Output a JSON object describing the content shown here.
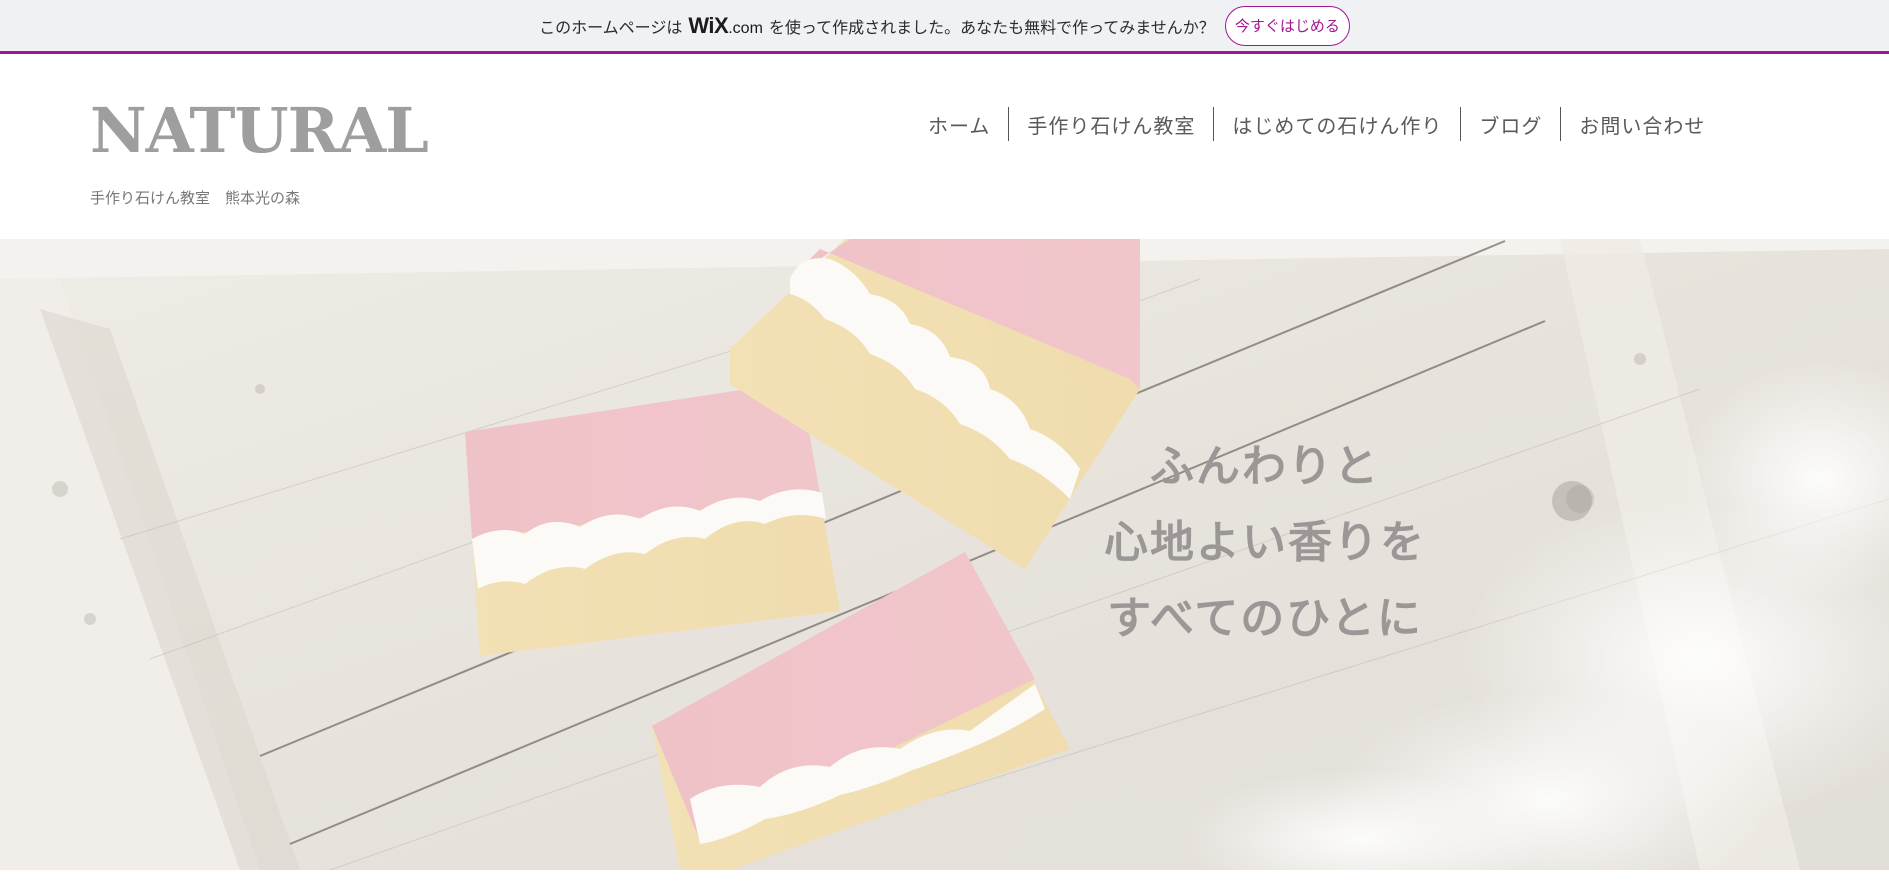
{
  "banner": {
    "message_before": "このホームページは",
    "wix_logo": "WiX",
    "wix_domain": ".com",
    "message_after": "を使って作成されました。あなたも無料で作ってみませんか？",
    "cta_label": "今すぐはじめる",
    "accent_color": "#a0168f"
  },
  "header": {
    "logo": "NATURAL",
    "tagline": "手作り石けん教室　熊本光の森",
    "nav": [
      {
        "label": "ホーム"
      },
      {
        "label": "手作り石けん教室"
      },
      {
        "label": "はじめての石けん作り"
      },
      {
        "label": "ブログ"
      },
      {
        "label": "お問い合わせ"
      }
    ]
  },
  "hero": {
    "lines": [
      "ふんわりと",
      "心地よい香りを",
      "すべてのひとに"
    ],
    "image_subject": "layered pink and yellow soap bars on a whitewashed wooden tray"
  }
}
